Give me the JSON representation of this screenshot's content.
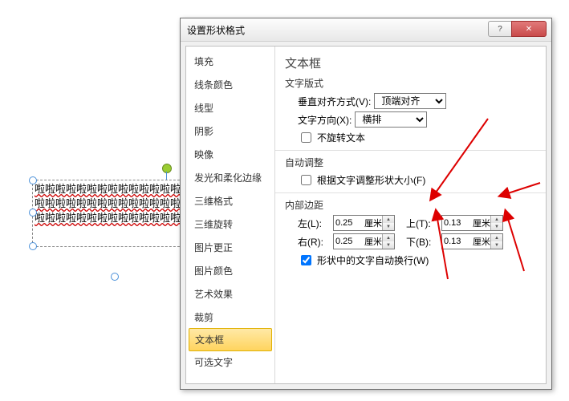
{
  "dialog": {
    "title": "设置形状格式",
    "help": "?",
    "close": "✕"
  },
  "sidebar": {
    "items": [
      "填充",
      "线条颜色",
      "线型",
      "阴影",
      "映像",
      "发光和柔化边缘",
      "三维格式",
      "三维旋转",
      "图片更正",
      "图片颜色",
      "艺术效果",
      "裁剪",
      "文本框",
      "可选文字"
    ],
    "selected_index": 12
  },
  "content": {
    "heading": "文本框",
    "text_layout": "文字版式",
    "valign_label": "垂直对齐方式(V):",
    "valign_value": "顶端对齐",
    "textdir_label": "文字方向(X):",
    "textdir_value": "横排",
    "no_rotate": "不旋转文本",
    "autofit": "自动调整",
    "resize_shape": "根据文字调整形状大小(F)",
    "margins": "内部边距",
    "left_label": "左(L):",
    "right_label": "右(R):",
    "top_label": "上(T):",
    "bottom_label": "下(B):",
    "left_val": "0.25",
    "right_val": "0.25",
    "top_val": "0.13",
    "bottom_val": "0.13",
    "unit": "厘米",
    "wrap": "形状中的文字自动换行(W)"
  },
  "canvas": {
    "text_line": "啦啦啦啦啦啦啦啦啦啦啦啦啦啦啦啦啦啦"
  }
}
